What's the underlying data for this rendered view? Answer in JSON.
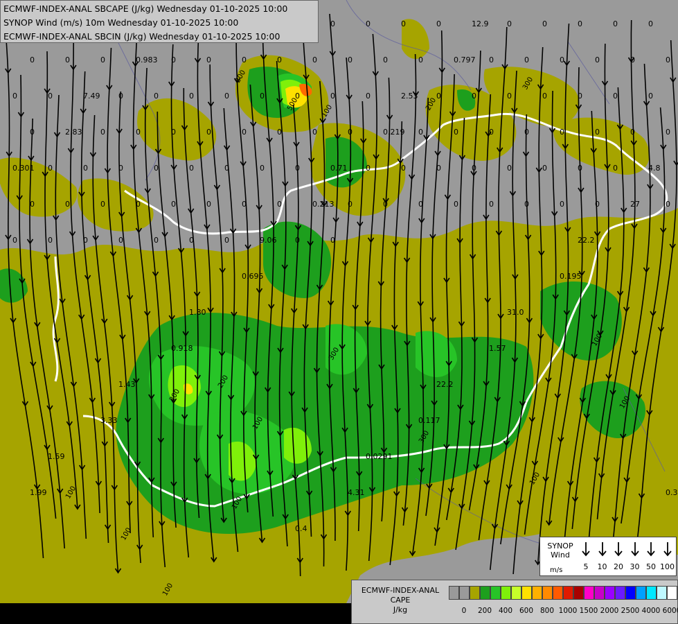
{
  "header": {
    "lines": [
      "ECMWF-INDEX-ANAL SBCAPE (J/kg) Wednesday 01-10-2025 10:00",
      "SYNOP Wind (m/s) 10m Wednesday 01-10-2025 10:00",
      "ECMWF-INDEX-ANAL SBCIN (J/kg) Wednesday 01-10-2025 10:00"
    ]
  },
  "map": {
    "background_color": "#9a9a9a",
    "outer_color": "#000000",
    "cape_colors": [
      "#a6a400",
      "#1d9f1d",
      "#27c427",
      "#7ff00a",
      "#c6ff2a",
      "#ffe000",
      "#ff6a00"
    ],
    "border_color": "#ffffff",
    "cin_labels": [
      "0",
      "0",
      "0",
      "0",
      "0",
      "0",
      "0",
      "0",
      "0",
      "0",
      "0",
      "0",
      "0",
      "0",
      "0",
      "0",
      "0",
      "0",
      "0",
      "0",
      "0",
      "0",
      "0",
      "0",
      "0",
      "0",
      "0",
      "0",
      "0",
      "0",
      "0",
      "0",
      "0",
      "0",
      "0",
      "0",
      "0",
      "0",
      "0",
      "0",
      "0",
      "0",
      "0",
      "0",
      "0",
      "0",
      "0",
      "0",
      "0",
      "0",
      "0",
      "0",
      "0",
      "0",
      "0",
      "0",
      "0",
      "0",
      "0",
      "0",
      "0",
      "0",
      "0",
      "0",
      "0",
      "0",
      "0",
      "0",
      "0",
      "0",
      "0",
      "0",
      "0",
      "0",
      "0",
      "0",
      "0",
      "0",
      "0",
      "0",
      "0",
      "0",
      "0",
      "0",
      "0",
      "0",
      "0",
      "0",
      "0",
      "0",
      "0",
      "0",
      "0",
      "0",
      "0",
      "0",
      "0",
      "0",
      "0",
      "0",
      "0",
      "0",
      "0",
      "0",
      "0",
      "0",
      "0",
      "0",
      "0",
      "0",
      "0.101",
      "12.9",
      "0.983",
      "0.797",
      "7.49",
      "2.53",
      "2.83",
      "0.219",
      "0.301",
      "0.71",
      "4.8",
      "0.213",
      "27",
      "9.06",
      "22.2",
      "0.695",
      "0.195",
      "1.80",
      "31.0",
      "0.918",
      "1.57",
      "1.43",
      "22.2",
      "3.33",
      "0.117",
      "1.59",
      "0.0291",
      "1.99",
      "4.31",
      "0.33",
      "0.4"
    ],
    "iso_labels": [
      "200",
      "500",
      "100",
      "300",
      "100",
      "200",
      "200",
      "100",
      "300",
      "100",
      "100",
      "100",
      "100",
      "100",
      "300",
      "200",
      "100"
    ]
  },
  "wind_legend": {
    "title_line1": "SYNOP",
    "title_line2": "Wind",
    "units": "m/s",
    "speeds": [
      "5",
      "10",
      "20",
      "30",
      "50",
      "100"
    ]
  },
  "cape_legend": {
    "title_line1": "ECMWF-INDEX-ANAL",
    "title_line2": "CAPE",
    "units": "J/kg",
    "colors": [
      "#9a9a9a",
      "#9a9a9a",
      "#a6a400",
      "#1d9f1d",
      "#27c427",
      "#7ff00a",
      "#c6ff2a",
      "#ffe000",
      "#ffb000",
      "#ff8a00",
      "#ff5a00",
      "#e01a00",
      "#a80000",
      "#ff00c8",
      "#c800c8",
      "#9a00ff",
      "#6a1aff",
      "#0000ff",
      "#00a0ff",
      "#00e8ff",
      "#bff8ff",
      "#ffffff"
    ],
    "ticks": [
      "0",
      "200",
      "400",
      "600",
      "800",
      "1000",
      "1500",
      "2000",
      "2500",
      "4000",
      "6000"
    ]
  }
}
